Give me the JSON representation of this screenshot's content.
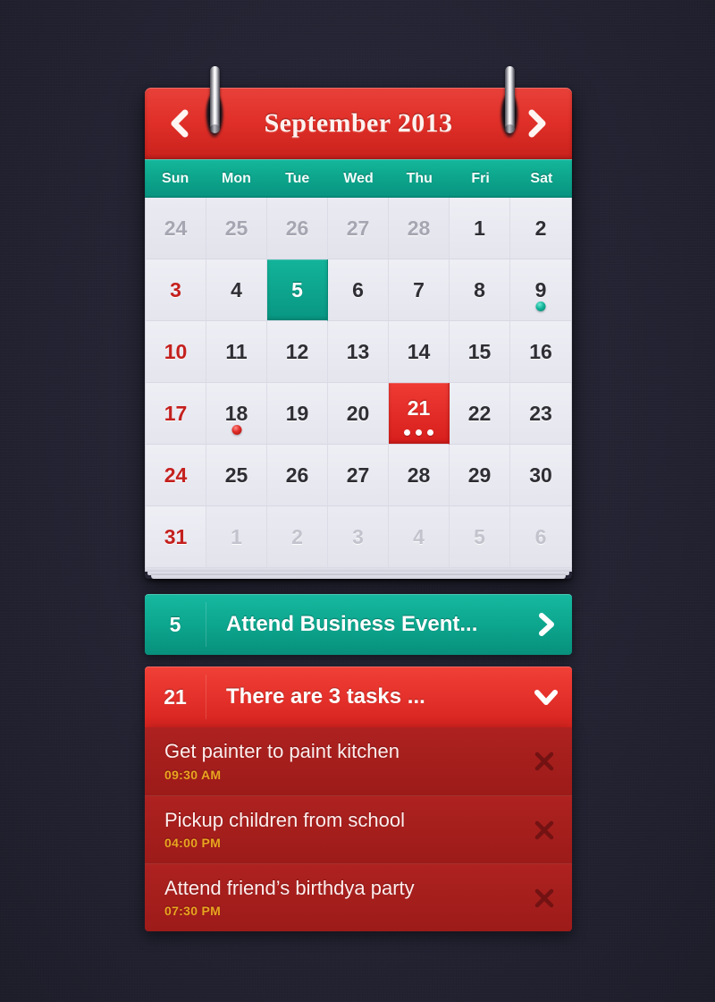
{
  "calendar": {
    "title": "September 2013",
    "prev_label": "chevron-left",
    "next_label": "chevron-right",
    "weekdays": [
      "Sun",
      "Mon",
      "Tue",
      "Wed",
      "Thu",
      "Fri",
      "Sat"
    ],
    "cells": [
      {
        "n": "24",
        "type": "prev"
      },
      {
        "n": "25",
        "type": "prev"
      },
      {
        "n": "26",
        "type": "prev"
      },
      {
        "n": "27",
        "type": "prev"
      },
      {
        "n": "28",
        "type": "prev"
      },
      {
        "n": "1",
        "type": "day"
      },
      {
        "n": "2",
        "type": "day"
      },
      {
        "n": "3",
        "type": "day",
        "sunday": true
      },
      {
        "n": "4",
        "type": "day"
      },
      {
        "n": "5",
        "type": "day",
        "selected": "teal"
      },
      {
        "n": "6",
        "type": "day"
      },
      {
        "n": "7",
        "type": "day"
      },
      {
        "n": "8",
        "type": "day"
      },
      {
        "n": "9",
        "type": "day",
        "marker": "teal"
      },
      {
        "n": "10",
        "type": "day",
        "sunday": true
      },
      {
        "n": "11",
        "type": "day"
      },
      {
        "n": "12",
        "type": "day"
      },
      {
        "n": "13",
        "type": "day"
      },
      {
        "n": "14",
        "type": "day"
      },
      {
        "n": "15",
        "type": "day"
      },
      {
        "n": "16",
        "type": "day"
      },
      {
        "n": "17",
        "type": "day",
        "sunday": true
      },
      {
        "n": "18",
        "type": "day",
        "marker": "red"
      },
      {
        "n": "19",
        "type": "day"
      },
      {
        "n": "20",
        "type": "day"
      },
      {
        "n": "21",
        "type": "day",
        "selected": "red",
        "dots": 3
      },
      {
        "n": "22",
        "type": "day"
      },
      {
        "n": "23",
        "type": "day"
      },
      {
        "n": "24",
        "type": "day",
        "sunday": true
      },
      {
        "n": "25",
        "type": "day"
      },
      {
        "n": "26",
        "type": "day"
      },
      {
        "n": "27",
        "type": "day"
      },
      {
        "n": "28",
        "type": "day"
      },
      {
        "n": "29",
        "type": "day"
      },
      {
        "n": "30",
        "type": "day"
      },
      {
        "n": "31",
        "type": "day",
        "sunday": true
      },
      {
        "n": "1",
        "type": "next"
      },
      {
        "n": "2",
        "type": "next"
      },
      {
        "n": "3",
        "type": "next"
      },
      {
        "n": "4",
        "type": "next"
      },
      {
        "n": "5",
        "type": "next"
      },
      {
        "n": "6",
        "type": "next"
      }
    ]
  },
  "events": [
    {
      "day": "5",
      "title": "Attend Business Event...",
      "chevron": "chevron-right"
    },
    {
      "day": "21",
      "title": "There are 3 tasks ...",
      "chevron": "chevron-down"
    }
  ],
  "tasks": [
    {
      "title": "Get painter to paint kitchen",
      "time": "09:30 AM",
      "close": "close-icon"
    },
    {
      "title": "Pickup children from school",
      "time": "04:00 PM",
      "close": "close-icon"
    },
    {
      "title": "Attend friend’s birthdya party",
      "time": "07:30 PM",
      "close": "close-icon"
    }
  ],
  "colors": {
    "background": "#242435",
    "header_red": "#e0302a",
    "teal": "#0ca48c",
    "selected_red": "#d71e1c",
    "task_red": "#a81f1f",
    "time_gold": "#e9a521",
    "sunday_red": "#c4201e"
  }
}
